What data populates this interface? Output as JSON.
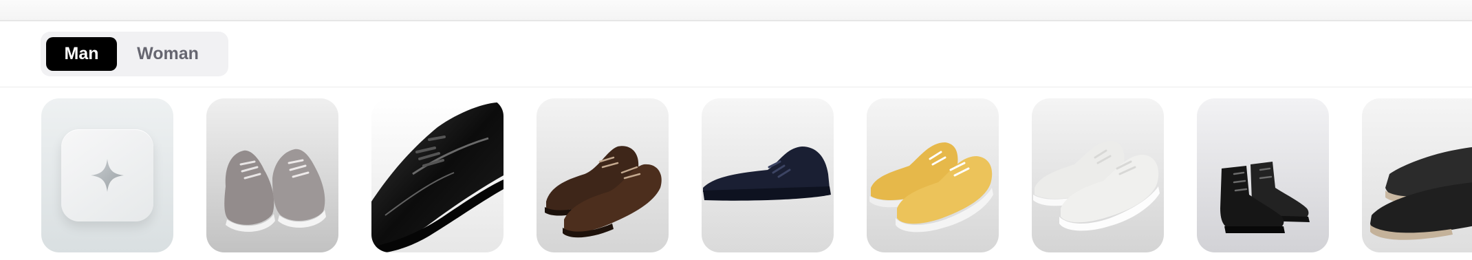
{
  "gender_toggle": {
    "options": [
      {
        "label": "Man",
        "selected": true
      },
      {
        "label": "Woman",
        "selected": false
      }
    ]
  },
  "product_cards": [
    {
      "icon": "sparkle-icon",
      "kind": "ai-generate"
    },
    {
      "icon": "grey-suede-sneaker-pair-image"
    },
    {
      "icon": "black-patent-derby-image"
    },
    {
      "icon": "brown-derby-pair-image"
    },
    {
      "icon": "navy-low-top-sneaker-image"
    },
    {
      "icon": "yellow-wool-sneaker-pair-image"
    },
    {
      "icon": "white-sneaker-pair-image"
    },
    {
      "icon": "black-lace-up-boot-pair-image"
    },
    {
      "icon": "black-suede-loafer-pair-image"
    }
  ],
  "colors": {
    "toggle_active_bg": "#000000",
    "toggle_active_text": "#ffffff",
    "toggle_inactive_text": "#666670",
    "toggle_track": "#f1f1f3"
  }
}
